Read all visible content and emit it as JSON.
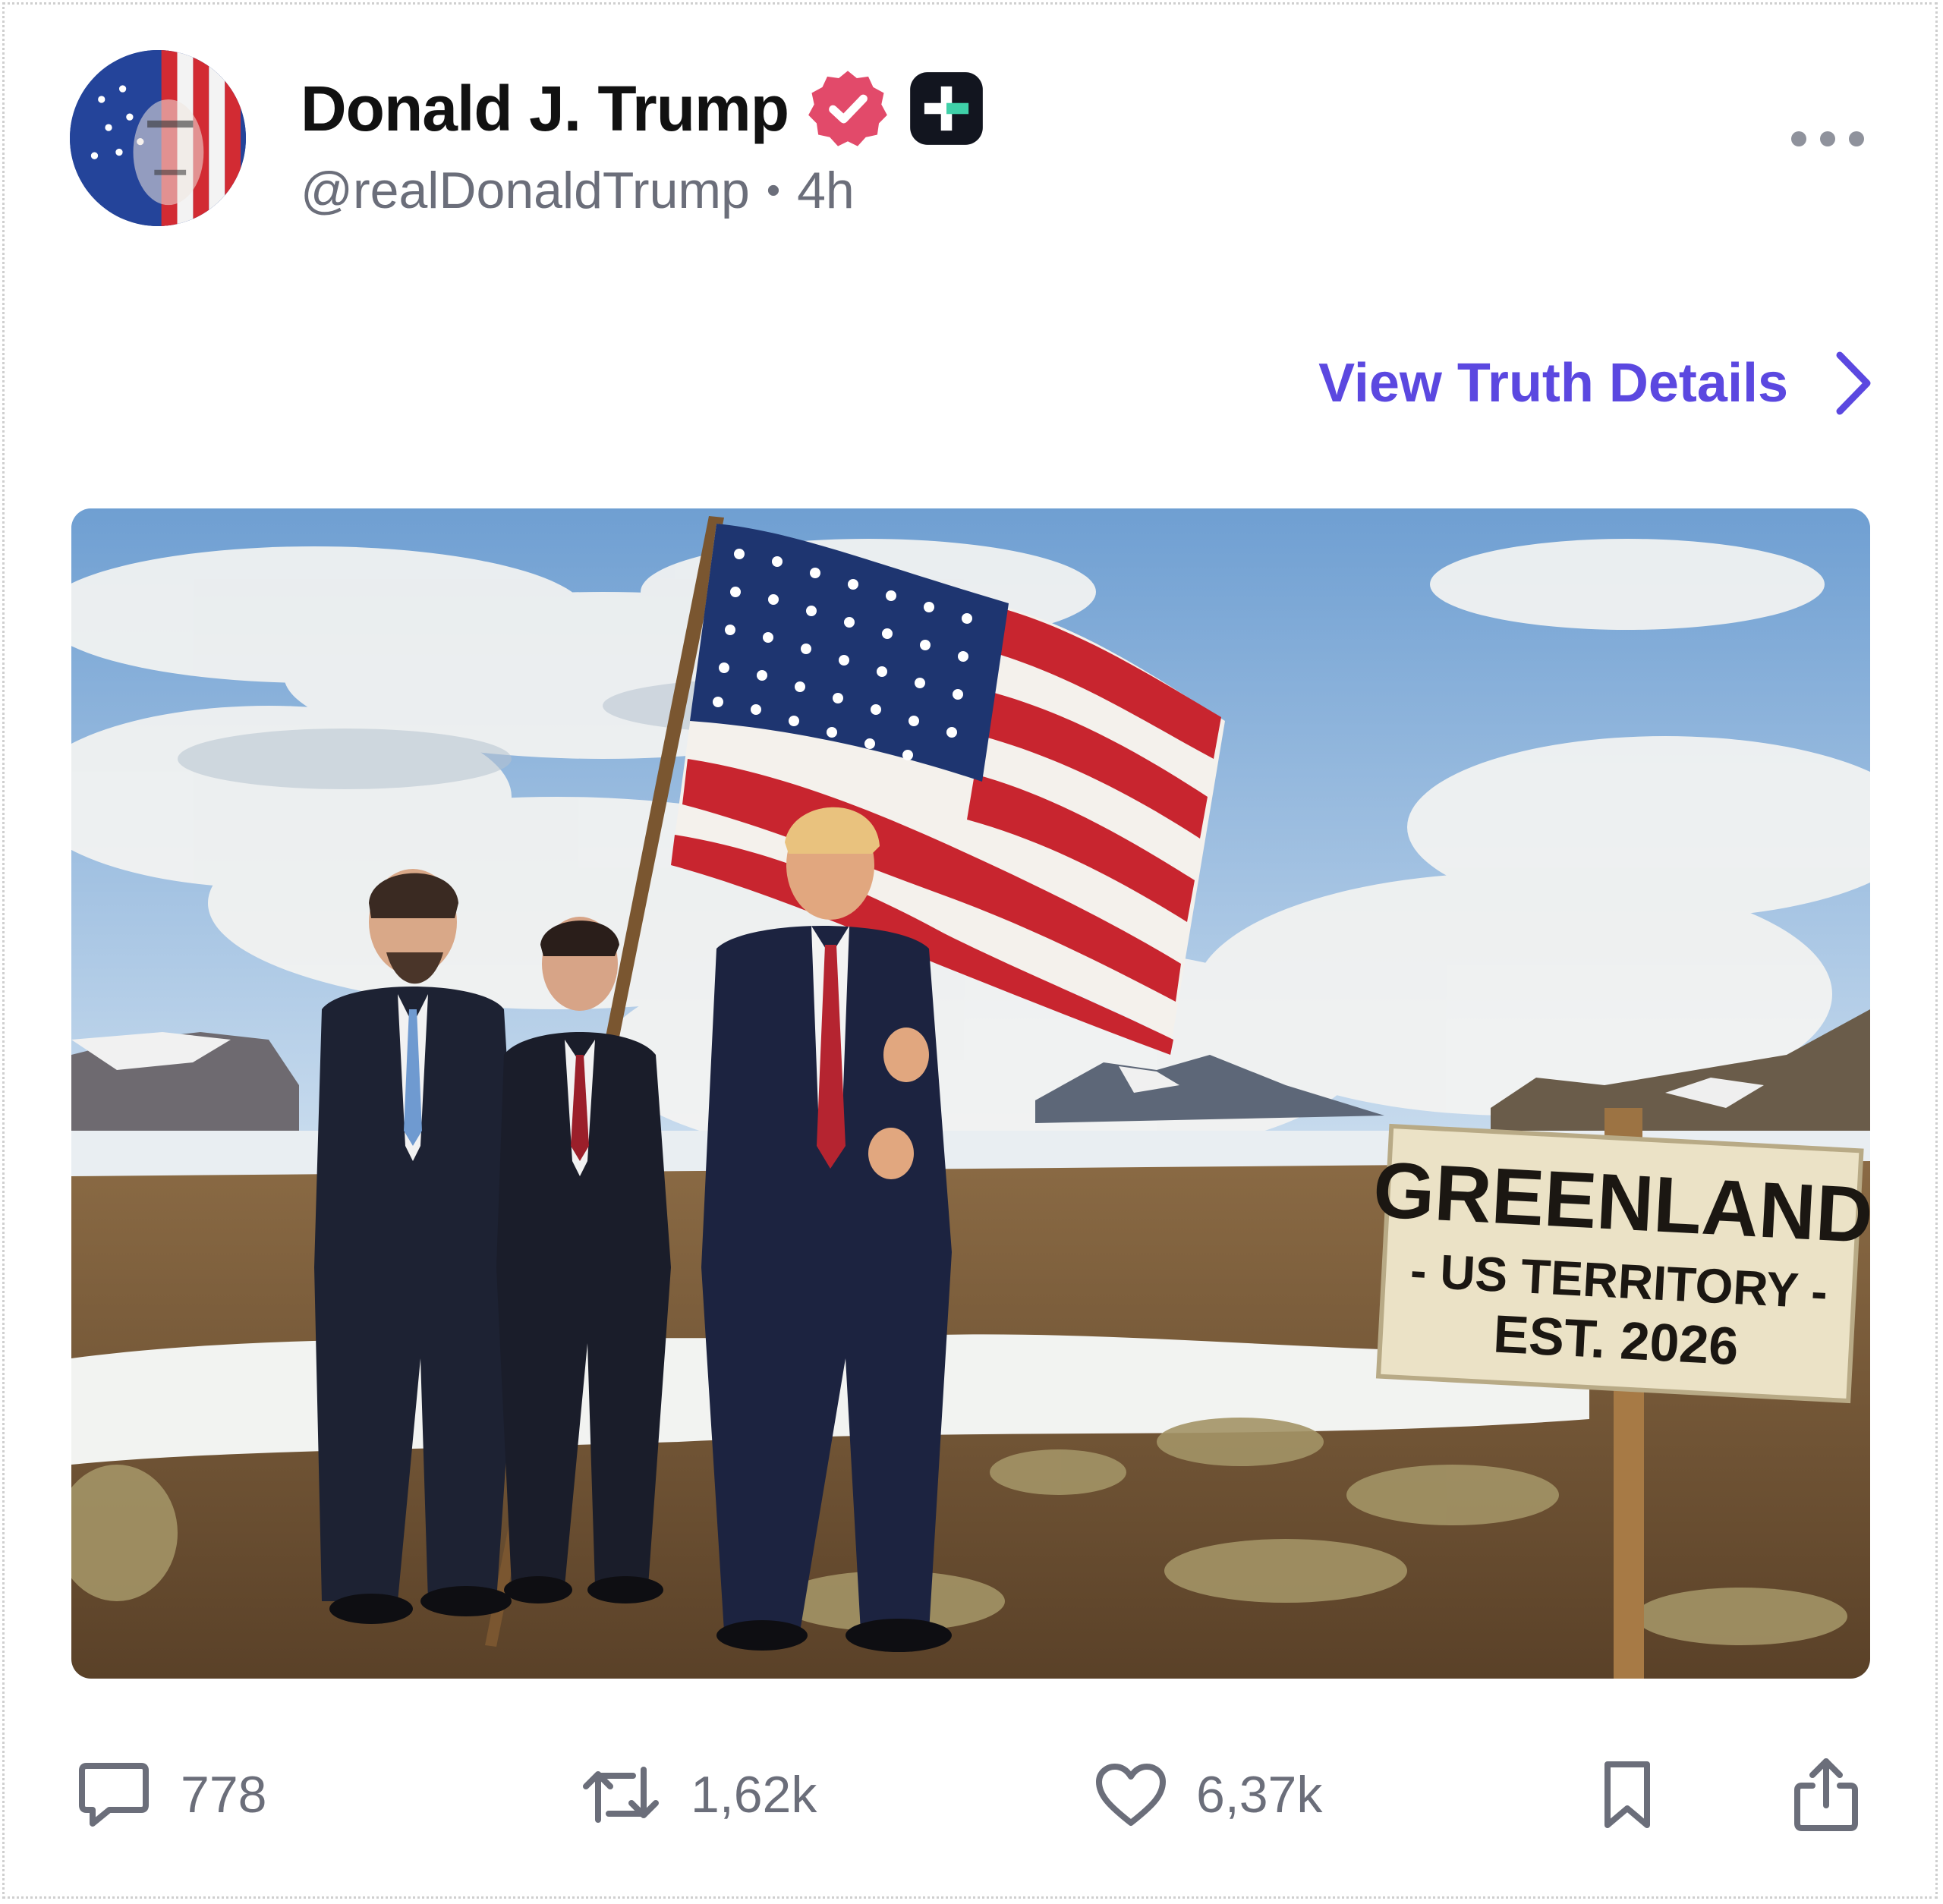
{
  "post": {
    "author": {
      "display_name": "Donald J. Trump",
      "handle": "@realDonaldTrump",
      "verified_icon": "verified-check-icon",
      "badge_icon": "plus-badge-icon"
    },
    "timestamp": "4h",
    "separator": "•",
    "more_icon": "more-options-icon",
    "details_link": {
      "label": "View Truth Details",
      "icon": "chevron-right-icon"
    },
    "image": {
      "sign_lines": [
        "GREENLAND",
        "- US TERRITORY -",
        "EST. 2026"
      ]
    },
    "actions": {
      "replies": "778",
      "retruths": "1,62k",
      "likes": "6,37k"
    }
  },
  "colors": {
    "accent": "#5b48e0",
    "verified": "#e24a6a",
    "muted_text": "#6b6e7a",
    "name_text": "#111111"
  }
}
